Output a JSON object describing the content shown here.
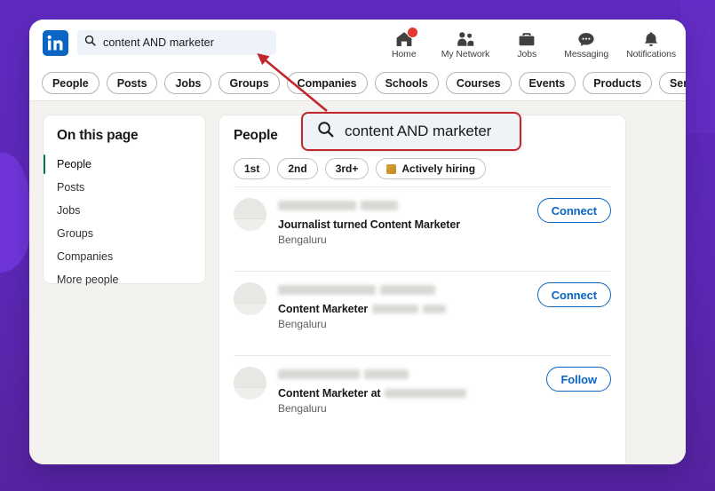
{
  "theme": {
    "background_purple": "#5b28b5",
    "blob_purple": "#7035d9",
    "linkedin_blue": "#0a66c2",
    "page_bg": "#f4f2ee",
    "callout_red": "#c1272d",
    "active_green": "#01754f",
    "badge_red": "#e5372f"
  },
  "header": {
    "logo_alt": "in",
    "search": {
      "value": "content AND marketer",
      "placeholder": "Search",
      "icon": "search-icon"
    },
    "nav": [
      {
        "label": "Home",
        "icon": "home-icon",
        "badge": true
      },
      {
        "label": "My Network",
        "icon": "people-icon",
        "badge": false
      },
      {
        "label": "Jobs",
        "icon": "briefcase-icon",
        "badge": false
      },
      {
        "label": "Messaging",
        "icon": "message-icon",
        "badge": false
      },
      {
        "label": "Notifications",
        "icon": "bell-icon",
        "badge": false
      }
    ],
    "filter_pills": [
      "People",
      "Posts",
      "Jobs",
      "Groups",
      "Companies",
      "Schools",
      "Courses",
      "Events",
      "Products",
      "Services"
    ]
  },
  "sidebar": {
    "title": "On this page",
    "items": [
      {
        "label": "People",
        "active": true
      },
      {
        "label": "Posts",
        "active": false
      },
      {
        "label": "Jobs",
        "active": false
      },
      {
        "label": "Groups",
        "active": false
      },
      {
        "label": "Companies",
        "active": false
      },
      {
        "label": "More people",
        "active": false
      }
    ]
  },
  "results": {
    "title": "People",
    "chips": [
      {
        "label": "1st",
        "icon": null
      },
      {
        "label": "2nd",
        "icon": null
      },
      {
        "label": "3rd+",
        "icon": null
      },
      {
        "label": "Actively hiring",
        "icon": "actively-hiring-icon"
      }
    ],
    "people": [
      {
        "name_redacted": true,
        "headline": "Journalist turned Content Marketer",
        "headline_redacted_suffix": false,
        "location": "Bengaluru",
        "action": "Connect"
      },
      {
        "name_redacted": true,
        "headline": "Content Marketer",
        "headline_redacted_suffix": true,
        "location": "Bengaluru",
        "action": "Connect"
      },
      {
        "name_redacted": true,
        "headline": "Content Marketer at",
        "headline_redacted_suffix": true,
        "location": "Bengaluru",
        "action": "Follow"
      }
    ]
  },
  "callout": {
    "text": "content AND marketer",
    "icon": "search-icon",
    "annotation": "red-arrow-pointing-to-search-bar"
  }
}
